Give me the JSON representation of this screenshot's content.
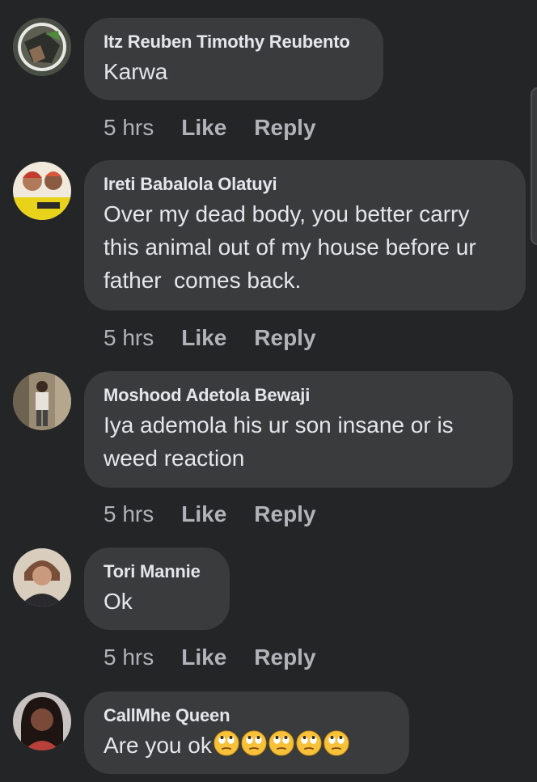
{
  "comments": [
    {
      "author": "Itz Reuben Timothy Reubento",
      "text": "Karwa",
      "time": "5 hrs",
      "like_label": "Like",
      "reply_label": "Reply",
      "avatar_color": "#6b6a5a"
    },
    {
      "author": "Ireti Babalola Olatuyi",
      "text": "Over my dead body, you better carry this animal out of my house before ur father  comes back.",
      "time": "5 hrs",
      "like_label": "Like",
      "reply_label": "Reply",
      "avatar_color": "#e8d21a"
    },
    {
      "author": "Moshood Adetola Bewaji",
      "text": "Iya ademola his ur son insane or is weed reaction",
      "time": "5 hrs",
      "like_label": "Like",
      "reply_label": "Reply",
      "avatar_color": "#8a7b66"
    },
    {
      "author": "Tori Mannie",
      "text": "Ok",
      "time": "5 hrs",
      "like_label": "Like",
      "reply_label": "Reply",
      "avatar_color": "#c9b39a"
    },
    {
      "author": "CallMhe Queen",
      "text": "Are you ok",
      "emoji": "face-with-rolling-eyes-emoji",
      "emoji_count": 5,
      "avatar_color": "#5a3a30"
    }
  ],
  "colors": {
    "background": "#242526",
    "bubble": "#3a3b3c",
    "primary_text": "#e4e6eb",
    "secondary_text": "#b0b3b8"
  }
}
